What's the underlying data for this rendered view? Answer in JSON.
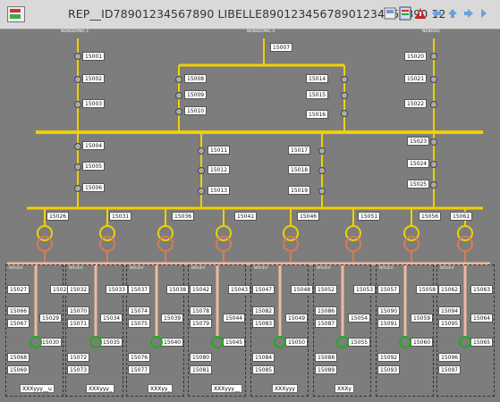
{
  "title": "REP__ID78901234567890 LIBELLE89012345678901234567890 12",
  "toolbar": {
    "buttons": [
      "print-icon",
      "document-icon",
      "alarm-icon",
      "arrow-left-icon",
      "arrow-up-icon",
      "arrow-back-icon",
      "arrow-forward-icon"
    ]
  },
  "colors": {
    "busbar": "#f0d000",
    "transformer": "#d97b50",
    "feeder": "#f0b8a0",
    "breaker": "#22aa22"
  },
  "sources": [
    {
      "name": "NENGDONG 1"
    },
    {
      "name": "NENGDONG II"
    },
    {
      "name": "NENGRO"
    }
  ],
  "incomer_labels": [
    "15001",
    "15002",
    "15003",
    "15007",
    "15020",
    "15021",
    "15022"
  ],
  "coupler_labels": [
    "15008",
    "15009",
    "15010",
    "15014",
    "15015",
    "15016"
  ],
  "middle_labels": [
    "15004",
    "15005",
    "15006",
    "15011",
    "15012",
    "15013",
    "15017",
    "15018",
    "15019",
    "15023",
    "15024",
    "15025"
  ],
  "bus_labels": [
    "15026",
    "15031",
    "15036",
    "15041",
    "15046",
    "15051",
    "15056",
    "15061"
  ],
  "tiny_texts": {
    "t1": "15016\nBYLRL00123",
    "t2": "5001\nBYLRL00123",
    "t3": "5001\nBYLRL00123",
    "t4": "15024\nBSLR6001",
    "t5": "15016\nBSLR6001",
    "t6": "5002\nBSLR6001",
    "t7": "5001\nBSLR6001",
    "t8": "5002\nBSLR6001",
    "t9": "15076\nBYLRL00123",
    "t10": "15077\nBYLRL00123",
    "t11": "15072\nBYLRL00123",
    "t12": "15021\nBYLRL00123"
  },
  "bays": [
    {
      "tag": "BRGEV",
      "labels": [
        "15027",
        "15028",
        "15029",
        "15066",
        "15067",
        "15030",
        "15068",
        "15069"
      ]
    },
    {
      "tag": "BRGEV",
      "labels": [
        "15032",
        "15033",
        "15070",
        "15071",
        "15034",
        "15035",
        "15072",
        "15073"
      ]
    },
    {
      "tag": "BRGEV",
      "labels": [
        "15037",
        "15038",
        "15074",
        "15075",
        "15039",
        "15040",
        "15076",
        "15077"
      ]
    },
    {
      "tag": "BRGEV",
      "labels": [
        "15042",
        "15043",
        "15078",
        "15079",
        "15044",
        "15045",
        "15080",
        "15081"
      ]
    },
    {
      "tag": "BRGEV",
      "labels": [
        "15047",
        "15048",
        "15082",
        "15083",
        "15049",
        "15050",
        "15084",
        "15085"
      ]
    },
    {
      "tag": "BRGEV",
      "labels": [
        "15052",
        "15053",
        "15086",
        "15087",
        "15054",
        "15055",
        "15088",
        "15089"
      ]
    },
    {
      "tag": "BRGEV",
      "labels": [
        "15057",
        "15058",
        "15090",
        "15091",
        "15059",
        "15060",
        "15092",
        "15093"
      ]
    },
    {
      "tag": "BRGEV",
      "labels": [
        "15062",
        "15063",
        "15094",
        "15095",
        "15064",
        "15065",
        "15096",
        "15097"
      ]
    }
  ],
  "footer": [
    "XXXyyy__u",
    "XXXyyy_",
    "XXXyy_",
    "XXXyyy__",
    "XXXyyy",
    "XXXy",
    "",
    ""
  ]
}
